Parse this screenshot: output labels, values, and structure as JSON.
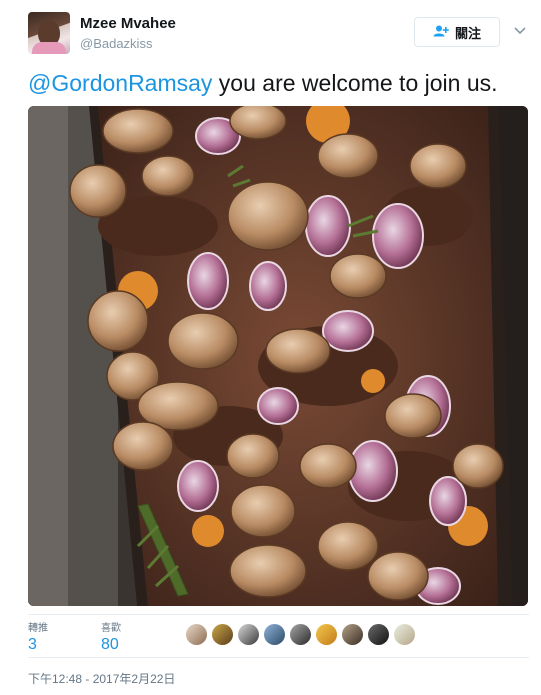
{
  "author": {
    "display_name": "Mzee Mvahee",
    "username": "@Badazkiss"
  },
  "header_actions": {
    "follow_label": "關注",
    "follow_icon": "add-user-icon",
    "menu_icon": "chevron-down-icon"
  },
  "tweet": {
    "mention": "@GordonRamsay",
    "text": " you are welcome to join us.",
    "photo_subject": "roasting-pan-with-steak-mushrooms-onions"
  },
  "stats": {
    "retweets_label": "轉推",
    "retweets_count": "3",
    "likes_label": "喜歡",
    "likes_count": "80"
  },
  "likers": [
    "liker-1",
    "liker-2",
    "liker-3",
    "liker-4",
    "liker-5",
    "liker-6",
    "liker-7",
    "liker-8",
    "liker-9"
  ],
  "timestamp": "下午12:48 - 2017年2月22日",
  "colors": {
    "link": "#1b95e0",
    "accent": "#1da1f2",
    "muted": "#657786",
    "border": "#e6ecf0"
  }
}
